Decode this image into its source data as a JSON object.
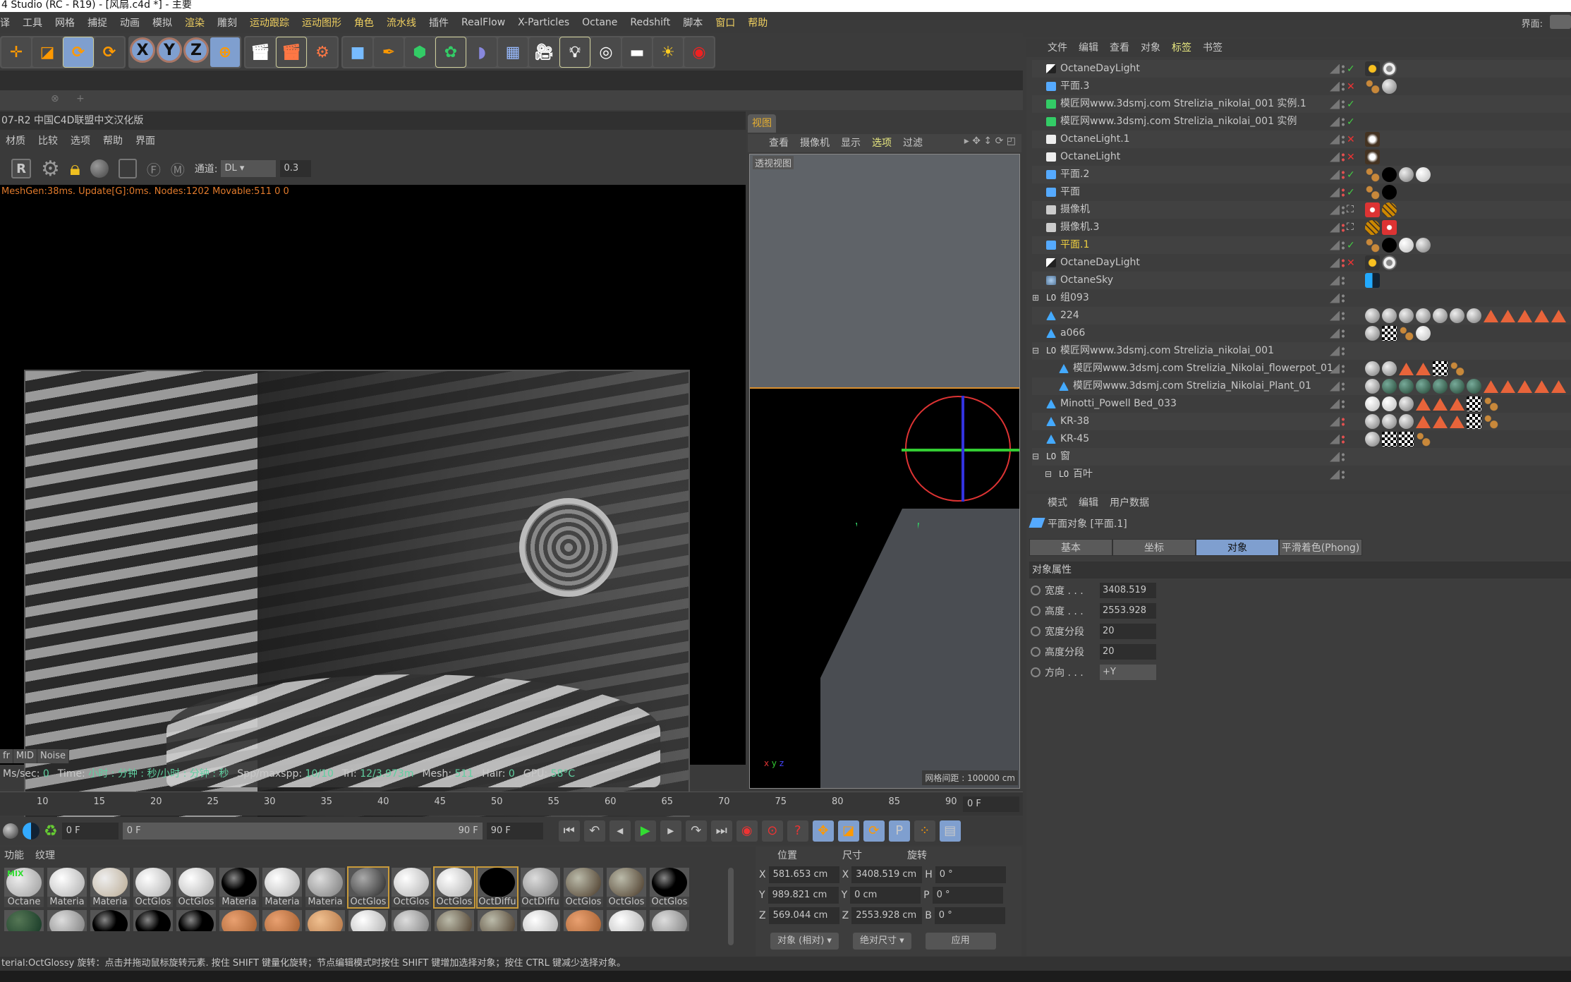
{
  "title": "4 Studio (RC - R19) - [风扇.c4d *] - 主要",
  "menu": [
    "译",
    "工具",
    "网格",
    "捕捉",
    "动画",
    "模拟",
    "渲染",
    "雕刻",
    "运动跟踪",
    "运动图形",
    "角色",
    "流水线",
    "插件",
    "RealFlow",
    "X-Particles",
    "Octane",
    "Redshift",
    "脚本",
    "窗口",
    "帮助"
  ],
  "menu_highlight": [
    "渲染",
    "运动跟踪",
    "运动图形",
    "角色",
    "流水线",
    "窗口",
    "帮助"
  ],
  "layout_label": "界面:",
  "toolbar": {
    "groups": [
      [
        "move-icon",
        "scale-icon",
        "rotate-icon",
        "rotate-recent-icon"
      ],
      [
        "x-axis-icon",
        "y-axis-icon",
        "z-axis-icon",
        "world-coords-icon"
      ],
      [
        "render-view-icon",
        "render-picture-icon",
        "render-settings-icon"
      ],
      [
        "cube-icon",
        "pen-icon",
        "subdivision-icon",
        "cloner-icon",
        "deformer-icon",
        "floor-icon",
        "camera-icon",
        "light-icon",
        "octane-area-light-icon",
        "octane-light-icon",
        "octane-daylight-icon",
        "octane-camera-icon"
      ]
    ],
    "axis_labels": [
      "X",
      "Y",
      "Z"
    ]
  },
  "live_viewer": {
    "title": "07-R2 中国C4D联盟中文汉化版",
    "menu": [
      "材质",
      "比较",
      "选项",
      "帮助",
      "界面"
    ],
    "channel_label": "通道:",
    "channel_value": "DL",
    "channel_amount": "0.3",
    "mesh_stat": "MeshGen:38ms. Update[G]:0ms. Nodes:1202 Movable:511  0 0",
    "tabs": [
      "fr",
      "MID",
      "Noise"
    ],
    "status": [
      {
        "k": "Ms/sec:",
        "v": "0"
      },
      {
        "k": "Time:",
        "v": "小时 : 分钟 : 秒/小时 : 分钟 : 秒"
      },
      {
        "k": "Spp/maxspp:",
        "v": "10/10"
      },
      {
        "k": "Tri:",
        "v": "12/3.973m"
      },
      {
        "k": "Mesh:",
        "v": "511"
      },
      {
        "k": "Hair:",
        "v": "0"
      },
      {
        "k": "GPU:",
        "v": "58°C"
      }
    ]
  },
  "viewport": {
    "tab": "视图",
    "menu": [
      "查看",
      "摄像机",
      "显示",
      "选项",
      "过滤"
    ],
    "active_menu": "选项",
    "view_label": "透视视图",
    "grid_spacing": "网格间距 : 100000 cm"
  },
  "object_manager": {
    "menu": [
      "文件",
      "编辑",
      "查看",
      "对象",
      "标签",
      "书签"
    ],
    "active_menu": "标签",
    "objects": [
      {
        "name": "OctaneDayLight",
        "icon": "daylight",
        "indent": 0,
        "status": "ok",
        "tags": [
          "sun",
          "ring"
        ]
      },
      {
        "name": "平面.3",
        "icon": "plane",
        "indent": 0,
        "status": "no",
        "tags": [
          "phong",
          "gray"
        ]
      },
      {
        "name": "模匠网www.3dsmj.com   Strelizia_nikolai_001 实例.1",
        "icon": "instance",
        "indent": 0,
        "status": "ok",
        "tags": []
      },
      {
        "name": "模匠网www.3dsmj.com   Strelizia_nikolai_001 实例",
        "icon": "instance",
        "indent": 0,
        "status": "ok",
        "tags": []
      },
      {
        "name": "OctaneLight.1",
        "icon": "light",
        "indent": 0,
        "status": "no",
        "tags": [
          "light"
        ]
      },
      {
        "name": "OctaneLight",
        "icon": "light",
        "indent": 0,
        "status": "no",
        "red": true,
        "tags": [
          "light"
        ]
      },
      {
        "name": "平面.2",
        "icon": "plane",
        "indent": 0,
        "status": "ok",
        "red": true,
        "tags": [
          "phong",
          "black",
          "gray",
          "white"
        ]
      },
      {
        "name": "平面",
        "icon": "plane",
        "indent": 0,
        "status": "ok",
        "red": true,
        "tags": [
          "phong",
          "black"
        ]
      },
      {
        "name": "摄像机",
        "icon": "camera",
        "indent": 0,
        "status": "cam",
        "tags": [
          "cam",
          "target"
        ]
      },
      {
        "name": "摄像机.3",
        "icon": "camera",
        "indent": 0,
        "status": "cam",
        "red": true,
        "tags": [
          "target",
          "cam"
        ]
      },
      {
        "name": "平面.1",
        "icon": "plane",
        "indent": 0,
        "status": "ok",
        "selected": true,
        "tags": [
          "phong",
          "black",
          "white",
          "gray"
        ]
      },
      {
        "name": "OctaneDayLight",
        "icon": "daylight",
        "indent": 0,
        "status": "no",
        "red": true,
        "tags": [
          "sun",
          "ring"
        ]
      },
      {
        "name": "OctaneSky",
        "icon": "sky",
        "indent": 0,
        "status": "",
        "tags": [
          "sky"
        ]
      },
      {
        "name": "组093",
        "icon": "null",
        "indent": 0,
        "status": "",
        "expand": "+",
        "tags": []
      },
      {
        "name": "224",
        "icon": "poly",
        "indent": 0,
        "status": "",
        "tags": [
          "gray",
          "gray",
          "gray",
          "gray",
          "gray",
          "gray",
          "gray",
          "tri",
          "tri",
          "tri",
          "tri",
          "tri"
        ]
      },
      {
        "name": "a066",
        "icon": "poly",
        "indent": 0,
        "status": "",
        "tags": [
          "gray",
          "check",
          "phong",
          "white"
        ]
      },
      {
        "name": "模匠网www.3dsmj.com   Strelizia_nikolai_001",
        "icon": "null",
        "indent": 0,
        "status": "",
        "expand": "-",
        "tags": []
      },
      {
        "name": "模匠网www.3dsmj.com   Strelizia_Nikolai_flowerpot_01",
        "icon": "poly",
        "indent": 1,
        "status": "",
        "tags": [
          "gray",
          "gray",
          "tri",
          "tri",
          "check",
          "phong"
        ]
      },
      {
        "name": "模匠网www.3dsmj.com   Strelizia_Nikolai_Plant_01",
        "icon": "poly",
        "indent": 1,
        "status": "",
        "tags": [
          "gray",
          "green",
          "green",
          "green",
          "green",
          "green",
          "green",
          "tri",
          "tri",
          "tri",
          "tri",
          "tri"
        ]
      },
      {
        "name": "Minotti_Powell Bed_033",
        "icon": "poly",
        "indent": 0,
        "status": "",
        "tags": [
          "white",
          "white",
          "gray",
          "tri",
          "tri",
          "tri",
          "check",
          "phong"
        ]
      },
      {
        "name": "KR-38",
        "icon": "poly",
        "indent": 0,
        "status": "",
        "red": true,
        "tags": [
          "gray",
          "gray",
          "gray",
          "tri",
          "tri",
          "tri",
          "check",
          "phong"
        ]
      },
      {
        "name": "KR-45",
        "icon": "poly",
        "indent": 0,
        "status": "",
        "red": true,
        "tags": [
          "gray",
          "check",
          "check",
          "phong"
        ]
      },
      {
        "name": "窗",
        "icon": "null",
        "indent": 0,
        "status": "",
        "expand": "-",
        "tags": []
      },
      {
        "name": "百叶",
        "icon": "null",
        "indent": 1,
        "status": "",
        "expand": "-",
        "tags": []
      }
    ]
  },
  "attributes": {
    "menu": [
      "模式",
      "编辑",
      "用户数据"
    ],
    "title": "平面对象 [平面.1]",
    "tabs": [
      "基本",
      "坐标",
      "对象",
      "平滑着色(Phong)"
    ],
    "active_tab": "对象",
    "section": "对象属性",
    "props": [
      {
        "label": "宽度 . . .",
        "value": "3408.519"
      },
      {
        "label": "高度 . . .",
        "value": "2553.928"
      },
      {
        "label": "宽度分段",
        "value": "20"
      },
      {
        "label": "高度分段",
        "value": "20"
      },
      {
        "label": "方向 . . .",
        "value": "+Y",
        "dropdown": true
      }
    ]
  },
  "timeline": {
    "ticks": [
      "10",
      "15",
      "20",
      "25",
      "30",
      "35",
      "40",
      "45",
      "50",
      "55",
      "60",
      "65",
      "70",
      "75",
      "80",
      "85",
      "90"
    ],
    "current_frame": "0 F"
  },
  "transport": {
    "start": "0 F",
    "range_start": "0 F",
    "range_end": "90 F",
    "end": "90 F"
  },
  "materials": {
    "menu": [
      "功能",
      "纹理"
    ],
    "row1": [
      {
        "n": "Octane",
        "c": "mix"
      },
      {
        "n": "Materia",
        "c": "white"
      },
      {
        "n": "Materia",
        "c": "beige"
      },
      {
        "n": "OctGlos",
        "c": "white"
      },
      {
        "n": "OctGlos",
        "c": "white"
      },
      {
        "n": "Materia",
        "c": "black"
      },
      {
        "n": "Materia",
        "c": "white"
      },
      {
        "n": "Materia",
        "c": "gray"
      },
      {
        "n": "OctGlos",
        "c": "dark",
        "sel": true
      },
      {
        "n": "OctGlos",
        "c": "white"
      },
      {
        "n": "OctGlos",
        "c": "white",
        "sel": true
      },
      {
        "n": "OctDiffu",
        "c": "pure-black",
        "sel": true
      },
      {
        "n": "OctDiffu",
        "c": "gray"
      },
      {
        "n": "OctGlos",
        "c": "brown"
      },
      {
        "n": "OctGlos",
        "c": "brown"
      },
      {
        "n": "OctGlos",
        "c": "black"
      }
    ],
    "row2": [
      "green",
      "gray",
      "black",
      "black",
      "black",
      "orange",
      "orange",
      "tan",
      "white",
      "gray",
      "brown",
      "brown",
      "white",
      "orange",
      "white",
      "gray"
    ]
  },
  "coordinates": {
    "headers": [
      "位置",
      "尺寸",
      "旋转"
    ],
    "rows": [
      {
        "a": "X",
        "p": "581.653 cm",
        "s": "3408.519 cm",
        "r": "H",
        "rv": "0 °"
      },
      {
        "a": "Y",
        "p": "989.821 cm",
        "s": "0 cm",
        "r": "P",
        "rv": "0 °"
      },
      {
        "a": "Z",
        "p": "569.044 cm",
        "s": "2553.928 cm",
        "r": "B",
        "rv": "0 °"
      }
    ],
    "mode": "对象 (相对)",
    "size_mode": "绝对尺寸",
    "apply": "应用"
  },
  "status_bar": "terial:OctGlossy    旋转：点击并拖动鼠标旋转元素. 按住 SHIFT 键量化旋转；节点编辑模式时按住 SHIFT 键增加选择对象；按住 CTRL 键减少选择对象。"
}
